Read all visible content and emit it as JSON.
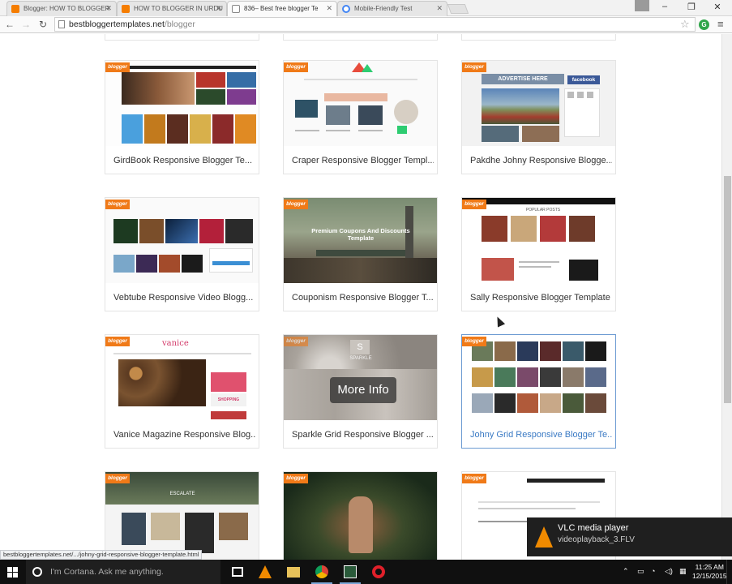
{
  "browser": {
    "tabs": [
      {
        "label": "Blogger: HOW TO BLOGGER",
        "icon": "blogger-icon"
      },
      {
        "label": "HOW TO BLOGGER IN URDU",
        "icon": "blogger-icon"
      },
      {
        "label": "836– Best free blogger Te",
        "icon": "page-icon",
        "active": true
      },
      {
        "label": "Mobile-Friendly Test",
        "icon": "google-icon"
      }
    ],
    "address": {
      "domain": "bestbloggertemplates.net",
      "path": "/blogger"
    },
    "window_controls": {
      "minimize": "–",
      "restore": "❐",
      "close": "✕"
    }
  },
  "page": {
    "ribbon_label": "blogger",
    "more_info_label": "More Info",
    "templates": [
      {
        "title": "GirdBook Responsive Blogger Te..."
      },
      {
        "title": "Craper Responsive Blogger Templ..."
      },
      {
        "title": "Pakdhe Johny Responsive Blogge..."
      },
      {
        "title": "Vebtube Responsive Video Blogg..."
      },
      {
        "title": "Couponism Responsive Blogger T..."
      },
      {
        "title": "Sally Responsive Blogger Template"
      },
      {
        "title": "Vanice Magazine Responsive Blog..."
      },
      {
        "title": "Sparkle Grid Responsive Blogger ..."
      },
      {
        "title": "Johny Grid Responsive Blogger Te..."
      }
    ],
    "thumb_text": {
      "advertise": "ADVERTISE HERE",
      "facebook": "facebook",
      "coupon_heading": "Premium Coupons And Discounts Template",
      "vanice_logo": "vanice",
      "sally_header": "POPULAR POSTS",
      "sparkle_logo": "SPARKLE",
      "escalate": "ESCALATE",
      "shopping": "SHOPPING"
    }
  },
  "status_url": "bestbloggertemplates.net/.../johny-grid-responsive-blogger-template.html",
  "notification": {
    "title": "VLC media player",
    "subtitle": "videoplayback_3.FLV"
  },
  "taskbar": {
    "search_placeholder": "I'm Cortana. Ask me anything.",
    "time": "11:25 AM",
    "date": "12/15/2015"
  },
  "colors": {
    "ribbon": "#f07a18",
    "link_selected": "#3a7ac4",
    "taskbar": "#101010"
  }
}
